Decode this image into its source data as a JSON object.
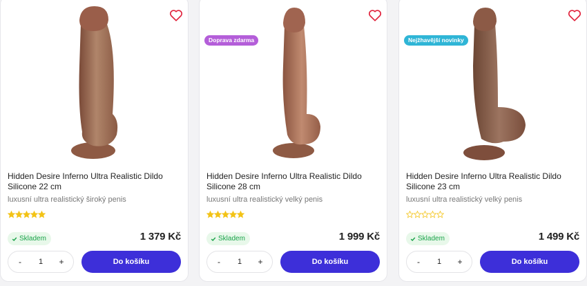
{
  "colors": {
    "accent": "#3d2fd9",
    "heart": "#e0213b",
    "star_filled": "#f3c316",
    "stock_green": "#1aa34a",
    "badge_free_shipping": "#b45ed9",
    "badge_hottest_new": "#2fb5d6"
  },
  "products": [
    {
      "title": "Hidden Desire Inferno Ultra Realistic Dildo Silicone 22 cm",
      "subtitle": "luxusní ultra realistický široký penis",
      "rating": 5,
      "max_rating": 5,
      "badge": "",
      "stock": "Skladem",
      "price": "1 379 Kč",
      "quantity": "1",
      "qty_minus": "-",
      "qty_plus": "+",
      "cart_label": "Do košíku",
      "wishlist_icon": "heart-icon"
    },
    {
      "title": "Hidden Desire Inferno Ultra Realistic Dildo Silicone 28 cm",
      "subtitle": "luxusní ultra realistický velký penis",
      "rating": 5,
      "max_rating": 5,
      "badge": "Doprava zdarma",
      "stock": "Skladem",
      "price": "1 999 Kč",
      "quantity": "1",
      "qty_minus": "-",
      "qty_plus": "+",
      "cart_label": "Do košíku",
      "wishlist_icon": "heart-icon"
    },
    {
      "title": "Hidden Desire Inferno Ultra Realistic Dildo Silicone 23 cm",
      "subtitle": "luxusní ultra realistický velký penis",
      "rating": 0,
      "max_rating": 5,
      "badge": "Nejžhavější novinky",
      "stock": "Skladem",
      "price": "1 499 Kč",
      "quantity": "1",
      "qty_minus": "-",
      "qty_plus": "+",
      "cart_label": "Do košíku",
      "wishlist_icon": "heart-icon"
    }
  ]
}
